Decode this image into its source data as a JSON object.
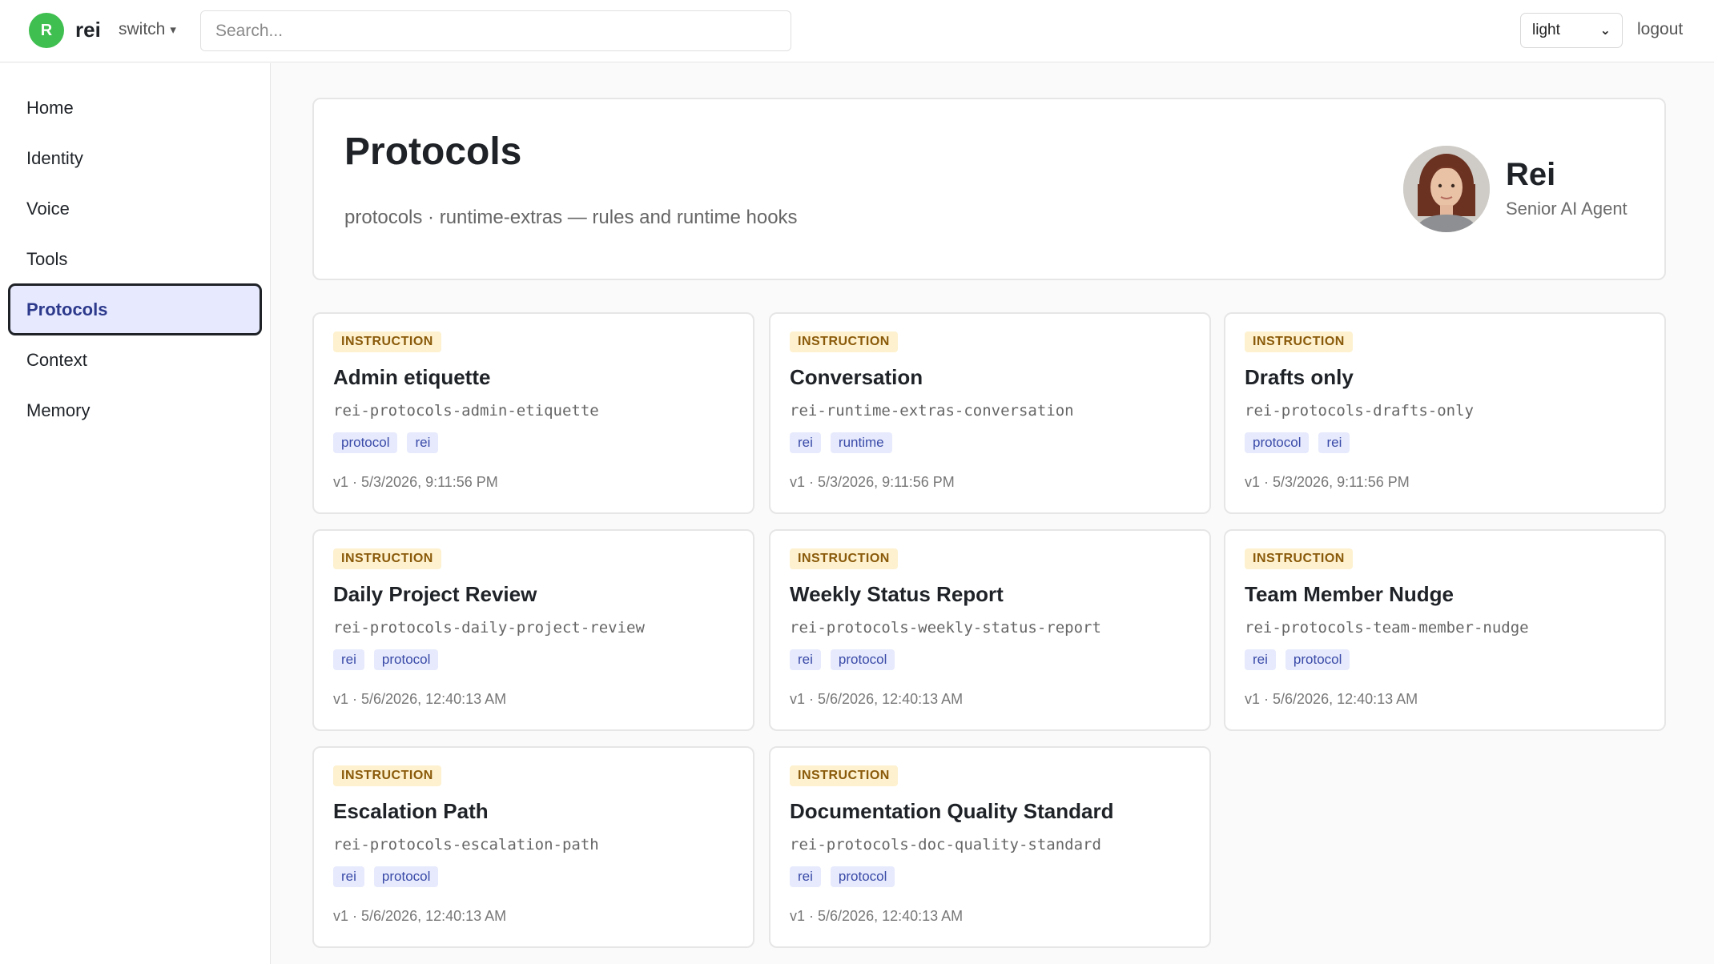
{
  "topbar": {
    "avatar_initial": "R",
    "brand": "rei",
    "switch_label": "switch",
    "search_placeholder": "Search...",
    "theme_value": "light",
    "logout_label": "logout"
  },
  "sidebar": {
    "items": [
      {
        "label": "Home",
        "active": false
      },
      {
        "label": "Identity",
        "active": false
      },
      {
        "label": "Voice",
        "active": false
      },
      {
        "label": "Tools",
        "active": false
      },
      {
        "label": "Protocols",
        "active": true
      },
      {
        "label": "Context",
        "active": false
      },
      {
        "label": "Memory",
        "active": false
      }
    ]
  },
  "header": {
    "title": "Protocols",
    "subtitle": "protocols · runtime-extras — rules and runtime hooks",
    "profile_name": "Rei",
    "profile_role": "Senior AI Agent"
  },
  "cards": [
    {
      "badge": "INSTRUCTION",
      "title": "Admin etiquette",
      "slug": "rei-protocols-admin-etiquette",
      "tags": [
        "protocol",
        "rei"
      ],
      "meta": "v1 · 5/3/2026, 9:11:56 PM"
    },
    {
      "badge": "INSTRUCTION",
      "title": "Conversation",
      "slug": "rei-runtime-extras-conversation",
      "tags": [
        "rei",
        "runtime"
      ],
      "meta": "v1 · 5/3/2026, 9:11:56 PM"
    },
    {
      "badge": "INSTRUCTION",
      "title": "Drafts only",
      "slug": "rei-protocols-drafts-only",
      "tags": [
        "protocol",
        "rei"
      ],
      "meta": "v1 · 5/3/2026, 9:11:56 PM"
    },
    {
      "badge": "INSTRUCTION",
      "title": "Daily Project Review",
      "slug": "rei-protocols-daily-project-review",
      "tags": [
        "rei",
        "protocol"
      ],
      "meta": "v1 · 5/6/2026, 12:40:13 AM"
    },
    {
      "badge": "INSTRUCTION",
      "title": "Weekly Status Report",
      "slug": "rei-protocols-weekly-status-report",
      "tags": [
        "rei",
        "protocol"
      ],
      "meta": "v1 · 5/6/2026, 12:40:13 AM"
    },
    {
      "badge": "INSTRUCTION",
      "title": "Team Member Nudge",
      "slug": "rei-protocols-team-member-nudge",
      "tags": [
        "rei",
        "protocol"
      ],
      "meta": "v1 · 5/6/2026, 12:40:13 AM"
    },
    {
      "badge": "INSTRUCTION",
      "title": "Escalation Path",
      "slug": "rei-protocols-escalation-path",
      "tags": [
        "rei",
        "protocol"
      ],
      "meta": "v1 · 5/6/2026, 12:40:13 AM"
    },
    {
      "badge": "INSTRUCTION",
      "title": "Documentation Quality Standard",
      "slug": "rei-protocols-doc-quality-standard",
      "tags": [
        "rei",
        "protocol"
      ],
      "meta": "v1 · 5/6/2026, 12:40:13 AM"
    }
  ],
  "colors": {
    "accent": "#3fbf4f",
    "active_nav_bg": "#e7eaff",
    "badge_bg": "#fdf1cf",
    "tag_bg": "#e6eafc"
  }
}
